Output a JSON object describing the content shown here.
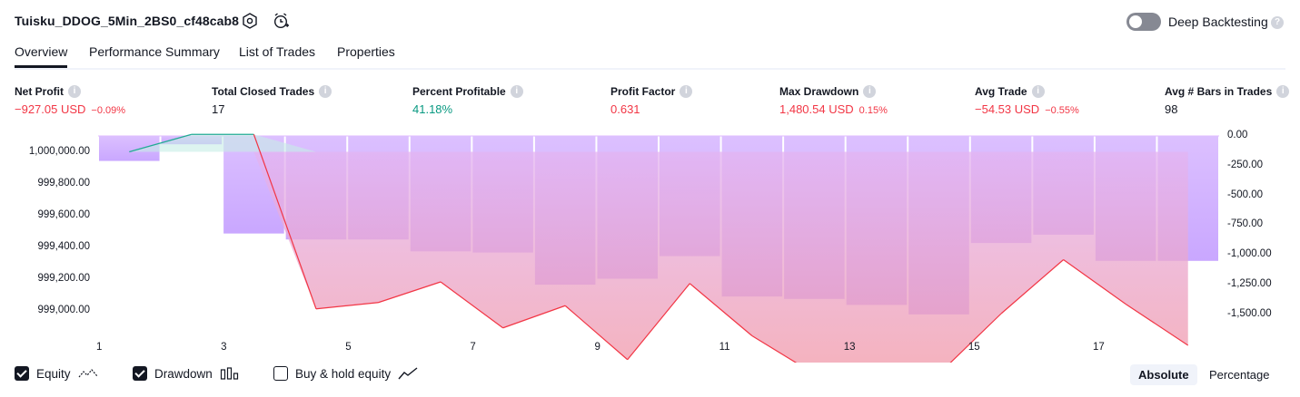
{
  "header": {
    "strategy_name": "Tuisku_DDOG_5Min_2BS0_cf48cab8",
    "settings_icon": "hexagon-gear-icon",
    "alert_icon": "alarm-clock-plus-icon",
    "deep_backtesting_label": "Deep Backtesting",
    "deep_backtesting_enabled": false,
    "help_icon_text": "?"
  },
  "tabs": [
    {
      "label": "Overview",
      "active": true
    },
    {
      "label": "Performance Summary",
      "active": false
    },
    {
      "label": "List of Trades",
      "active": false
    },
    {
      "label": "Properties",
      "active": false
    }
  ],
  "metrics": [
    {
      "label": "Net Profit",
      "value": "−927.05 USD",
      "sub": "−0.09%",
      "color": "#f23645"
    },
    {
      "label": "Total Closed Trades",
      "value": "17",
      "sub": "",
      "color": "#131722"
    },
    {
      "label": "Percent Profitable",
      "value": "41.18%",
      "sub": "",
      "color": "#089981"
    },
    {
      "label": "Profit Factor",
      "value": "0.631",
      "sub": "",
      "color": "#f23645"
    },
    {
      "label": "Max Drawdown",
      "value": "1,480.54 USD",
      "sub": "0.15%",
      "color": "#f23645"
    },
    {
      "label": "Avg Trade",
      "value": "−54.53 USD",
      "sub": "−0.55%",
      "color": "#f23645"
    },
    {
      "label": "Avg # Bars in Trades",
      "value": "98",
      "sub": "",
      "color": "#131722"
    }
  ],
  "chart_data": {
    "type": "line",
    "x": [
      1,
      2,
      3,
      4,
      5,
      6,
      7,
      8,
      9,
      10,
      11,
      12,
      13,
      14,
      15,
      16,
      17,
      18
    ],
    "x_tick_labels": [
      "1",
      "3",
      "5",
      "7",
      "9",
      "11",
      "13",
      "15",
      "17"
    ],
    "left_axis": {
      "tick_labels": [
        "1,000,000.00",
        "999,800.00",
        "999,600.00",
        "999,400.00",
        "999,200.00",
        "999,000.00"
      ],
      "ylim": [
        998900,
        1000100
      ]
    },
    "right_axis": {
      "tick_labels": [
        "0.00",
        "-250.00",
        "-500.00",
        "-750.00",
        "-1,000.00",
        "-1,250.00",
        "-1,500.00"
      ],
      "ylim": [
        -1600,
        0
      ]
    },
    "series": [
      {
        "name": "Equity",
        "axis": "left",
        "color_above": "#22ab94",
        "color_below": "#f23645",
        "values": [
          1000000,
          1000110,
          1000110,
          999010,
          999050,
          999180,
          998890,
          999030,
          998690,
          999170,
          998840,
          998600,
          998600,
          998600,
          998980,
          999320,
          999040,
          998780
        ]
      },
      {
        "name": "Drawdown",
        "axis": "right",
        "color": "#c9a7ff",
        "values": [
          -210,
          -70,
          -820,
          -870,
          -870,
          -970,
          -980,
          -1250,
          -1200,
          -1010,
          -1350,
          -1370,
          -1420,
          -1500,
          -900,
          -830,
          -1050,
          -1050
        ]
      }
    ],
    "grid": false
  },
  "legend": {
    "items": [
      {
        "label": "Equity",
        "checked": true,
        "icon": "equity-line-icon"
      },
      {
        "label": "Drawdown",
        "checked": true,
        "icon": "drawdown-bars-icon"
      },
      {
        "label": "Buy & hold equity",
        "checked": false,
        "icon": "buy-hold-line-icon"
      }
    ],
    "mode_options": [
      "Absolute",
      "Percentage"
    ],
    "mode_selected": "Absolute"
  },
  "colors": {
    "text": "#131722",
    "negative": "#f23645",
    "positive": "#089981",
    "drawdown_bar": "#c9a7ff",
    "toggle_off": "#868993"
  }
}
